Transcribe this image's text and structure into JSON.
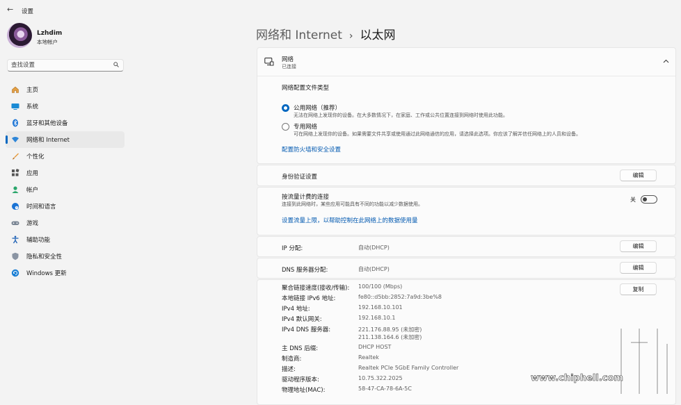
{
  "window": {
    "title": "设置",
    "back_glyph": "←"
  },
  "profile": {
    "name": "Lzhdim",
    "account": "本地帐户"
  },
  "search": {
    "placeholder": "查找设置",
    "icon": "search-icon"
  },
  "nav": {
    "items": [
      {
        "label": "主页",
        "icon": "home-icon",
        "active": false
      },
      {
        "label": "系统",
        "icon": "system-display-icon",
        "active": false
      },
      {
        "label": "蓝牙和其他设备",
        "icon": "bluetooth-icon",
        "active": false
      },
      {
        "label": "网络和 Internet",
        "icon": "network-icon",
        "active": true
      },
      {
        "label": "个性化",
        "icon": "brush-icon",
        "active": false
      },
      {
        "label": "应用",
        "icon": "apps-icon",
        "active": false
      },
      {
        "label": "帐户",
        "icon": "account-icon",
        "active": false
      },
      {
        "label": "时间和语言",
        "icon": "globe-clock-icon",
        "active": false
      },
      {
        "label": "游戏",
        "icon": "gamepad-icon",
        "active": false
      },
      {
        "label": "辅助功能",
        "icon": "accessibility-icon",
        "active": false
      },
      {
        "label": "隐私和安全性",
        "icon": "shield-icon",
        "active": false
      },
      {
        "label": "Windows 更新",
        "icon": "windows-update-icon",
        "active": false
      }
    ]
  },
  "breadcrumb": {
    "parent": "网络和 Internet",
    "separator": "›",
    "current": "以太网"
  },
  "network_card": {
    "title": "网络",
    "status": "已连接",
    "profile_heading": "网络配置文件类型",
    "public": {
      "label": "公用网络（推荐）",
      "desc": "无法在网络上发现你的设备。在大多数情况下，在家庭、工作或公共位置连接到网络时使用此功能。",
      "selected": true
    },
    "private": {
      "label": "专用网络",
      "desc": "可在网络上发现你的设备。如果需要文件共享或使用通过此网络通信的应用，请选择此选项。你应该了解并信任网络上的人员和设备。",
      "selected": false
    },
    "firewall_link": "配置防火墙和安全设置"
  },
  "auth": {
    "label": "身份验证设置",
    "button": "编辑"
  },
  "metered": {
    "label": "按流量计费的连接",
    "desc": "连接到此网络时，某些应用可能具有不同的功能以减少数据使用。",
    "toggle_state": "关",
    "link": "设置流量上限，以帮助控制在此网络上的数据使用量"
  },
  "ip": {
    "label": "IP 分配:",
    "value": "自动(DHCP)",
    "button": "编辑"
  },
  "dns": {
    "label": "DNS 服务器分配:",
    "value": "自动(DHCP)",
    "button": "编辑"
  },
  "properties": {
    "copy_button": "复制",
    "rows": [
      {
        "label": "聚合链接速度(接收/传输):",
        "value": "100/100 (Mbps)"
      },
      {
        "label": "本地链接 IPv6 地址:",
        "value": "fe80::d5bb:2852:7a9d:3be%8"
      },
      {
        "label": "IPv4 地址:",
        "value": "192.168.10.101"
      },
      {
        "label": "IPv4 默认网关:",
        "value": "192.168.10.1"
      },
      {
        "label": "IPv4 DNS 服务器:",
        "value": "221.176.88.95 (未加密)",
        "value2": "211.138.164.6 (未加密)"
      },
      {
        "label": "主 DNS 后缀:",
        "value": "DHCP HOST"
      },
      {
        "label": "制造商:",
        "value": "Realtek"
      },
      {
        "label": "描述:",
        "value": "Realtek PCIe 5GbE Family Controller"
      },
      {
        "label": "驱动程序版本:",
        "value": "10.75.322.2025"
      },
      {
        "label": "物理地址(MAC):",
        "value": "58-47-CA-78-6A-5C"
      }
    ]
  },
  "watermark": {
    "url": "www.chiphell.com"
  }
}
